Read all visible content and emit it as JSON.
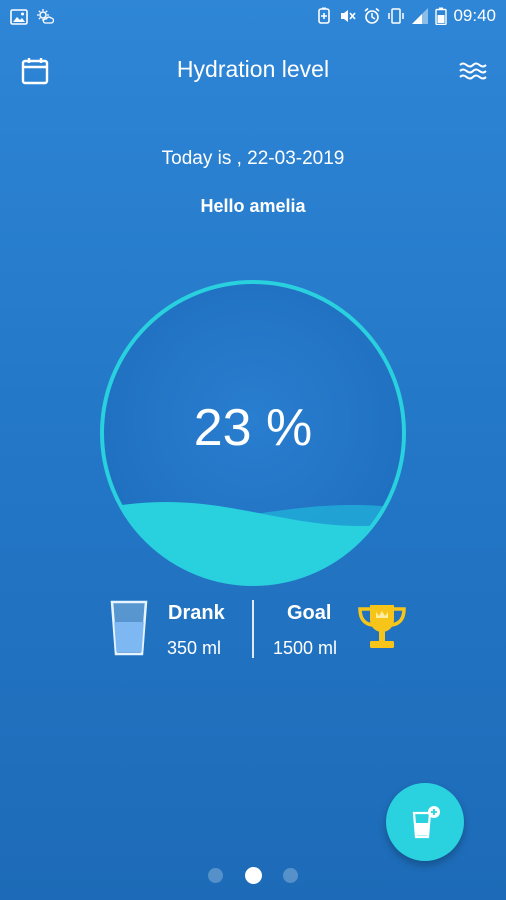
{
  "status_bar": {
    "time": "09:40"
  },
  "app_bar": {
    "title": "Hydration level",
    "calendar_icon": "calendar-icon",
    "menu_icon": "waves-icon"
  },
  "greeting": {
    "today_text": "Today is , 22-03-2019",
    "hello_prefix": "Hello",
    "user_name": "amelia"
  },
  "gauge": {
    "percent_text": "23 %",
    "fill_fraction": 0.23,
    "ring_color": "#29d0de",
    "water_color": "#29d0de"
  },
  "stats": {
    "drank_label": "Drank",
    "drank_value": "350 ml",
    "goal_label": "Goal",
    "goal_value": "1500 ml"
  },
  "fab": {
    "icon": "add-glass-icon"
  },
  "pager": {
    "page_count": 3,
    "current_page": 2
  },
  "colors": {
    "accent": "#2ad2df",
    "trophy": "#f7c519"
  }
}
